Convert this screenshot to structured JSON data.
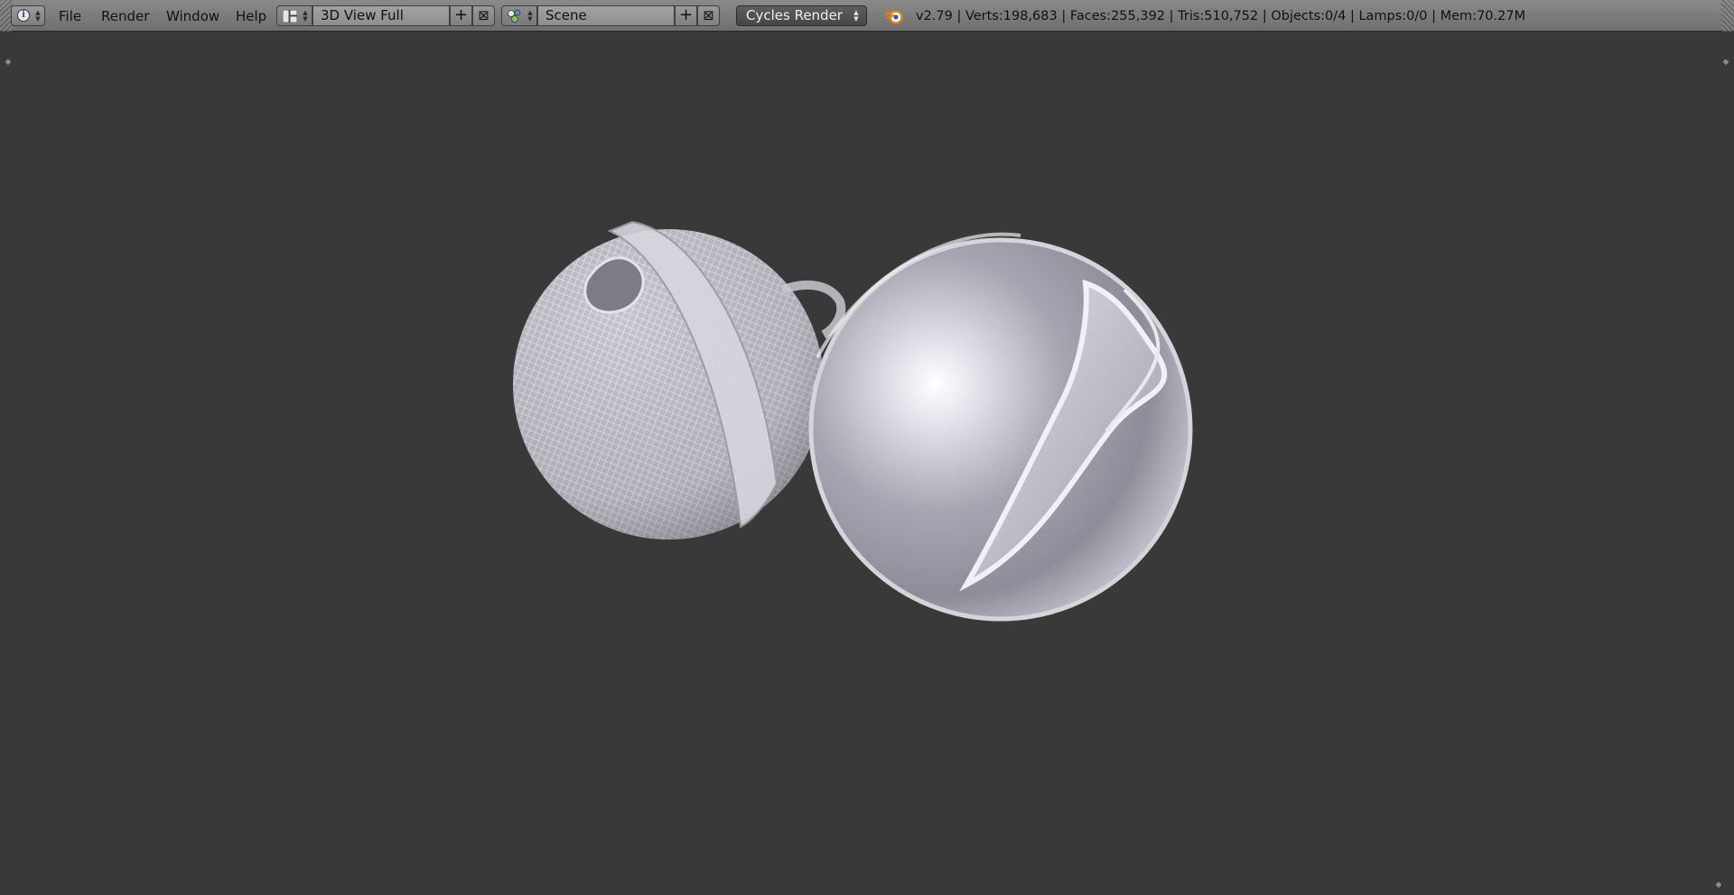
{
  "window": {
    "editor_type_icon": "info-icon",
    "menu": [
      "File",
      "Render",
      "Window",
      "Help"
    ],
    "screen_layout": {
      "icon": "screen-layout-icon",
      "value": "3D View Full"
    },
    "scene": {
      "icon": "scene-icon",
      "value": "Scene"
    },
    "render_engine": "Cycles Render",
    "stats": "v2.79 | Verts:198,683 | Faces:255,392 | Tris:510,752 | Objects:0/4 | Lamps:0/0 | Mem:70.27M",
    "logo_icon": "blender-logo-icon"
  },
  "colors": {
    "header_bg": "#7f7f7f",
    "viewport_bg": "#393939",
    "render_engine_bg": "#4f4f4f",
    "sphere_metal": "#c9c9d4"
  }
}
